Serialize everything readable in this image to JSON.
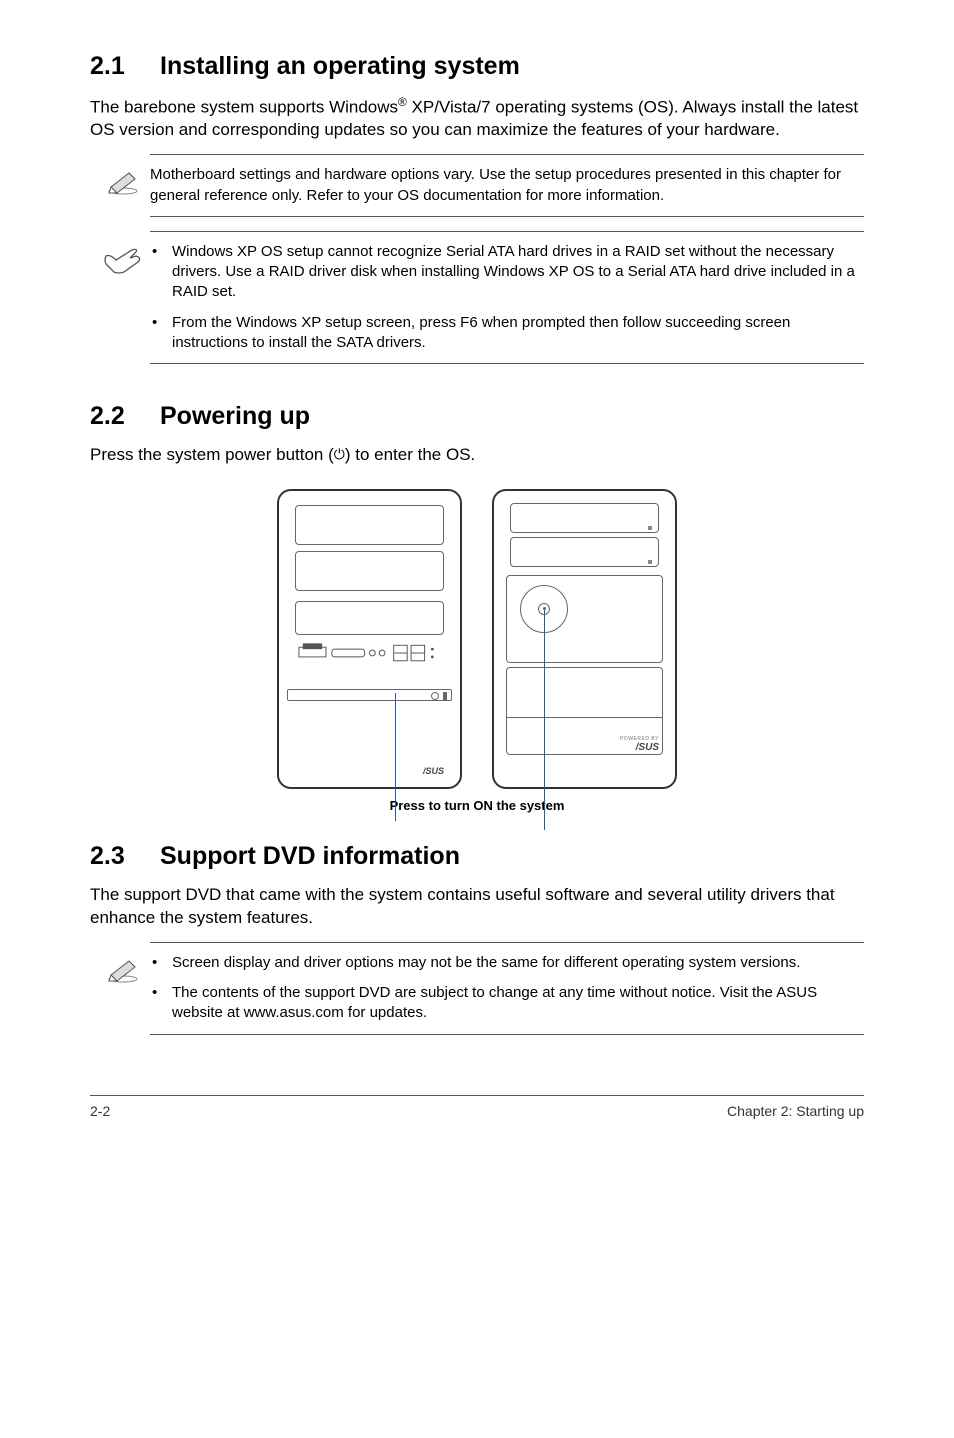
{
  "sections": {
    "s1": {
      "num": "2.1",
      "title": "Installing an operating system",
      "body_pre": "The barebone system supports Windows",
      "sup": "®",
      "body_post": " XP/Vista/7 operating systems (OS). Always install the latest OS version and corresponding updates so you can maximize the features of your hardware.",
      "note1": "Motherboard settings and hardware options vary. Use the setup procedures presented in this chapter for general reference only. Refer to your OS documentation for more information.",
      "note2_items": [
        "Windows XP OS setup cannot recognize Serial ATA hard drives in a RAID set without the necessary drivers. Use a RAID driver disk when installing Windows XP OS to a Serial ATA hard drive included in a RAID set.",
        "From the Windows XP setup screen, press F6 when prompted then follow succeeding screen instructions to install the SATA drivers."
      ]
    },
    "s2": {
      "num": "2.2",
      "title": "Powering up",
      "body_pre": "Press the system power button (",
      "body_post": ") to enter the OS.",
      "caption": "Press to turn ON the system"
    },
    "s3": {
      "num": "2.3",
      "title": "Support DVD information",
      "body": "The support DVD that came with the system contains useful software and several utility drivers that enhance the system features.",
      "note_items": [
        "Screen display and driver options may not be the same for different operating system versions.",
        "The contents of the support DVD are subject to change at any time without notice. Visit the ASUS website at www.asus.com for updates."
      ]
    }
  },
  "footer": {
    "left": "2-2",
    "right": "Chapter 2: Starting up"
  },
  "icons": {
    "pencil_title": "note-pencil-icon",
    "hand_title": "note-hand-icon"
  }
}
